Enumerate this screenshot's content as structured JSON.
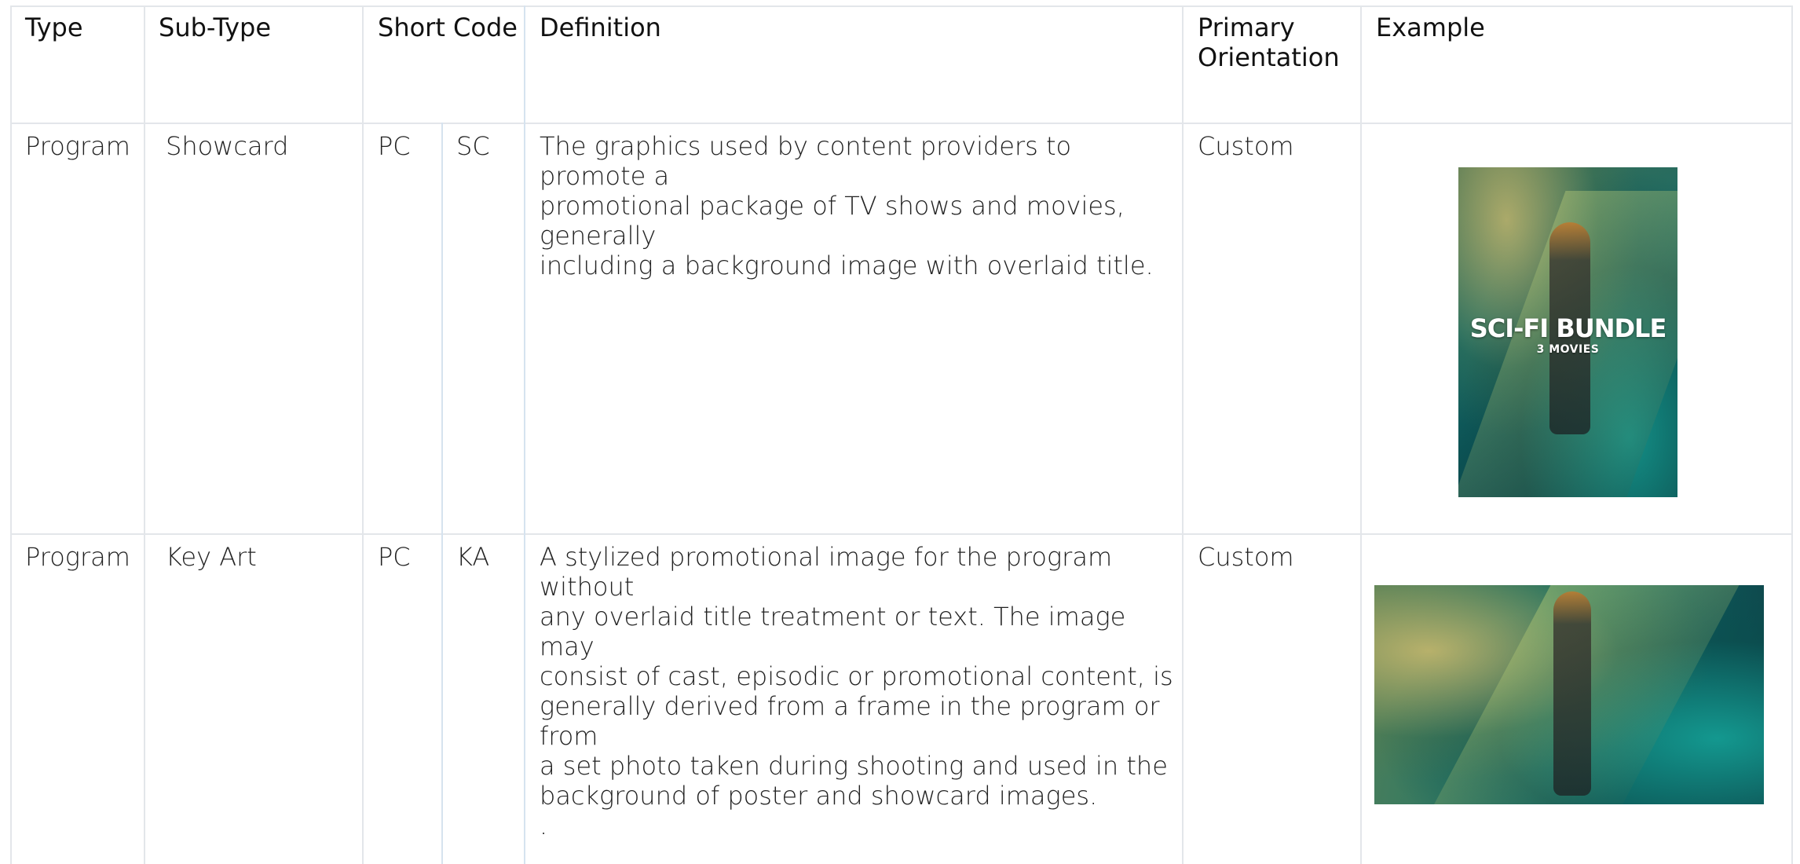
{
  "table": {
    "headers": {
      "type": "Type",
      "subtype": "Sub-Type",
      "short_code": "Short Code",
      "definition": "Definition",
      "primary_orientation": "Primary\nOrientation",
      "example": "Example"
    },
    "rows": [
      {
        "type": "Program",
        "subtype": "Showcard",
        "code_1": "PC",
        "code_2": "SC",
        "definition": "The graphics used by content providers to promote a\npromotional package of TV shows and movies, generally\nincluding a background image with overlaid title.",
        "orientation": "Custom",
        "example": {
          "title": "SCI-FI BUNDLE",
          "subtitle": "3 MOVIES"
        }
      },
      {
        "type": "Program",
        "subtype": "Key Art",
        "code_1": "PC",
        "code_2": "KA",
        "definition": "A stylized promotional image for the program without\nany overlaid title treatment or text. The image may\nconsist of cast, episodic or promotional content, is\ngenerally derived from a frame in the program or from\na set photo taken during shooting and used in the\nbackground of poster and showcard images.\n.",
        "orientation": "Custom"
      }
    ]
  }
}
